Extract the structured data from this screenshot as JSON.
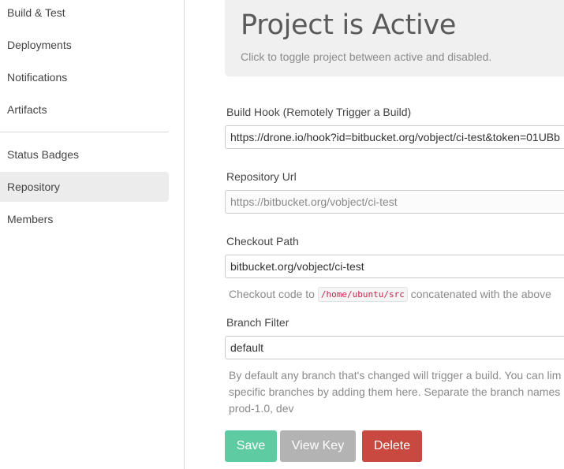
{
  "sidebar": {
    "items": [
      {
        "label": "Build & Test"
      },
      {
        "label": "Deployments"
      },
      {
        "label": "Notifications"
      },
      {
        "label": "Artifacts"
      },
      {
        "label": "Status Badges"
      },
      {
        "label": "Repository",
        "active": true
      },
      {
        "label": "Members"
      }
    ]
  },
  "header": {
    "title": "Project is Active",
    "subtitle": "Click to toggle project between active and disabled."
  },
  "form": {
    "build_hook": {
      "label": "Build Hook (Remotely Trigger a Build)",
      "value": "https://drone.io/hook?id=bitbucket.org/vobject/ci-test&token=01UBb"
    },
    "repo_url": {
      "label": "Repository Url",
      "value": "https://bitbucket.org/vobject/ci-test"
    },
    "checkout_path": {
      "label": "Checkout Path",
      "value": "bitbucket.org/vobject/ci-test",
      "help_prefix": "Checkout code to",
      "help_code": "/home/ubuntu/src",
      "help_suffix": "concatenated with the above"
    },
    "branch_filter": {
      "label": "Branch Filter",
      "value": "default",
      "help_line1": "By default any branch that's changed will trigger a build. You can lim",
      "help_line2": "specific branches by adding them here. Separate the branch names",
      "help_line3": "prod-1.0, dev"
    }
  },
  "actions": {
    "save": "Save",
    "view_key": "View Key",
    "delete": "Delete"
  },
  "colors": {
    "save": "#5ecba2",
    "view_key": "#b3b3b3",
    "delete": "#c9483f",
    "code": "#c7254e"
  }
}
